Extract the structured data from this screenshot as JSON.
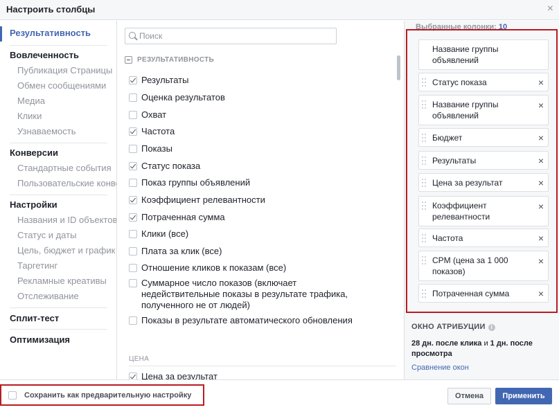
{
  "dialog": {
    "title": "Настроить столбцы",
    "close_icon": "×"
  },
  "nav": {
    "items": [
      {
        "label": "Результативность",
        "type": "group",
        "active": true
      },
      {
        "label": "Вовлеченность",
        "type": "group"
      },
      {
        "label": "Публикация Страницы",
        "type": "sub"
      },
      {
        "label": "Обмен сообщениями",
        "type": "sub"
      },
      {
        "label": "Медиа",
        "type": "sub"
      },
      {
        "label": "Клики",
        "type": "sub"
      },
      {
        "label": "Узнаваемость",
        "type": "sub"
      },
      {
        "label": "Конверсии",
        "type": "group"
      },
      {
        "label": "Стандартные события",
        "type": "sub"
      },
      {
        "label": "Пользовательские конверсии",
        "type": "sub"
      },
      {
        "label": "Настройки",
        "type": "group"
      },
      {
        "label": "Названия и ID объектов",
        "type": "sub"
      },
      {
        "label": "Статус и даты",
        "type": "sub"
      },
      {
        "label": "Цель, бюджет и график",
        "type": "sub"
      },
      {
        "label": "Таргетинг",
        "type": "sub"
      },
      {
        "label": "Рекламные креативы",
        "type": "sub"
      },
      {
        "label": "Отслеживание",
        "type": "sub"
      },
      {
        "label": "Сплит-тест",
        "type": "group"
      },
      {
        "label": "Оптимизация",
        "type": "group"
      }
    ]
  },
  "search": {
    "placeholder": "Поиск",
    "value": ""
  },
  "list": {
    "section_title": "РЕЗУЛЬТАТИВНОСТЬ",
    "rows": [
      {
        "label": "Результаты",
        "checked": true
      },
      {
        "label": "Оценка результатов",
        "checked": false
      },
      {
        "label": "Охват",
        "checked": false
      },
      {
        "label": "Частота",
        "checked": true
      },
      {
        "label": "Показы",
        "checked": false
      },
      {
        "label": "Статус показа",
        "checked": true
      },
      {
        "label": "Показ группы объявлений",
        "checked": false
      },
      {
        "label": "Коэффициент релевантности",
        "checked": true
      },
      {
        "label": "Потраченная сумма",
        "checked": true
      },
      {
        "label": "Клики (все)",
        "checked": false
      },
      {
        "label": "Плата за клик (все)",
        "checked": false
      },
      {
        "label": "Отношение кликов к показам (все)",
        "checked": false
      },
      {
        "label": "Суммарное число показов (включает недействительные показы в результате трафика, полученного не от людей)",
        "checked": false
      },
      {
        "label": "Показы в результате автоматического обновления",
        "checked": false
      }
    ],
    "price_section": "ЦЕНА",
    "price_rows": [
      {
        "label": "Цена за результат",
        "checked": true
      }
    ]
  },
  "selected": {
    "title": "Выбранные колонки:",
    "count": "10",
    "columns": [
      {
        "label": "Название группы объявлений",
        "fixed": true
      },
      {
        "label": "Статус показа"
      },
      {
        "label": "Название группы объявлений"
      },
      {
        "label": "Бюджет"
      },
      {
        "label": "Результаты"
      },
      {
        "label": "Цена за результат"
      },
      {
        "label": "Коэффициент релевантности"
      },
      {
        "label": "Частота"
      },
      {
        "label": "CPM (цена за 1 000 показов)"
      },
      {
        "label": "Потраченная сумма"
      }
    ],
    "remove_icon": "×"
  },
  "attribution": {
    "title": "ОКНО АТРИБУЦИИ",
    "info_icon": "i",
    "part1": "28 дн. после клика",
    "part2": " и ",
    "part3": "1 дн. после просмотра",
    "link": "Сравнение окон"
  },
  "footer": {
    "save_preset_label": "Сохранить как предварительную настройку",
    "save_preset_checked": false,
    "cancel_label": "Отмена",
    "apply_label": "Применить"
  },
  "colors": {
    "accent": "#4267b2",
    "highlight_red": "#b81c22"
  }
}
